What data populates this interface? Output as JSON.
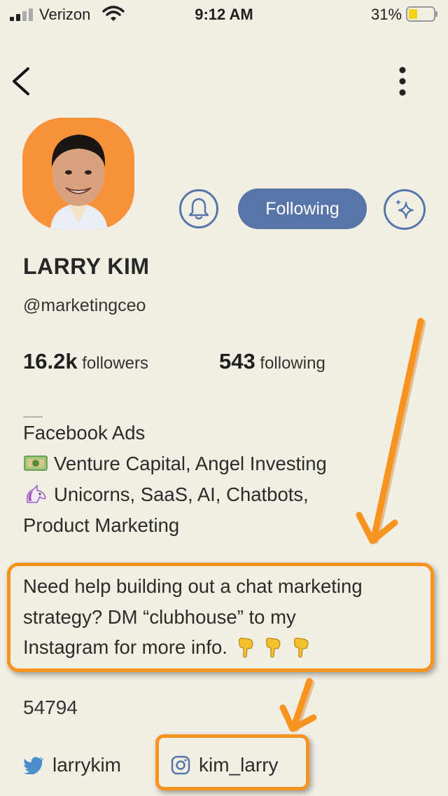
{
  "status_bar": {
    "carrier": "Verizon",
    "time": "9:12 AM",
    "battery": "31%"
  },
  "profile": {
    "name": "LARRY KIM",
    "handle": "@marketingceo",
    "followers_count": "16.2k",
    "followers_label": "followers",
    "following_count": "543",
    "following_label": "following"
  },
  "actions": {
    "following_label": "Following"
  },
  "bio": {
    "line1": "Facebook Ads",
    "line2": "Venture Capital, Angel Investing",
    "line3": "Unicorns, SaaS, AI, Chatbots,",
    "line4": "Product Marketing",
    "promo1": "Need help building out a chat marketing",
    "promo2": "strategy? DM “clubhouse” to my",
    "promo3": "Instagram for more info.",
    "number": "54794"
  },
  "links": {
    "twitter": "larrykim",
    "instagram": "kim_larry"
  },
  "colors": {
    "background": "#f1efe4",
    "accent": "#5775a9",
    "annotation": "#f7931e"
  }
}
